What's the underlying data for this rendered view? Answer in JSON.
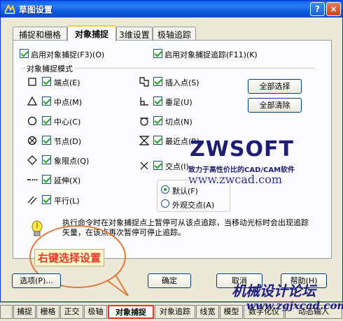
{
  "window": {
    "title": "草图设置",
    "help_glyph": "?",
    "close_glyph": "×"
  },
  "tabs": [
    {
      "label": "捕捉和栅格",
      "active": false
    },
    {
      "label": "对象捕捉",
      "active": true
    },
    {
      "label": "3维设置",
      "active": false
    },
    {
      "label": "极轴追踪",
      "active": false
    }
  ],
  "options": {
    "snap_on": "启用对象捕捉(F3)(O)",
    "track_on": "启用对象捕捉追踪(F11)(K)"
  },
  "group": {
    "title": "对象捕捉模式",
    "left": [
      {
        "label": "端点(E)",
        "icon": "square-icon"
      },
      {
        "label": "中点(M)",
        "icon": "triangle-icon"
      },
      {
        "label": "中心(C)",
        "icon": "circle-icon"
      },
      {
        "label": "节点(D)",
        "icon": "node-icon"
      },
      {
        "label": "象限点(Q)",
        "icon": "diamond-icon"
      },
      {
        "label": "延伸(X)",
        "icon": "extension-icon"
      },
      {
        "label": "平行(L)",
        "icon": "parallel-icon"
      }
    ],
    "right": [
      {
        "label": "插入点(S)",
        "icon": "insert-icon"
      },
      {
        "label": "垂足(U)",
        "icon": "perpendicular-icon"
      },
      {
        "label": "切点(N)",
        "icon": "tangent-icon"
      },
      {
        "label": "最近点(R)",
        "icon": "nearest-icon"
      },
      {
        "label": "交点(I)",
        "icon": "intersection-icon"
      }
    ],
    "select_all": "全部选择",
    "clear_all": "全部清除",
    "radio_default": "默认(F)",
    "radio_apparent": "外观交点(A)"
  },
  "hint": "执行命令时在对象捕捉点上暂停可从该点追踪，当移动光标时会出现追踪矢量，在该点再次暂停可停止追踪。",
  "buttons": {
    "options": "选项(P)...",
    "ok": "确定",
    "cancel": "取消",
    "help": "帮助(H)"
  },
  "watermark": {
    "logo": "ZWSOFT",
    "slogan": "致力于高性价比的CAD/CAM软件",
    "url": "www.zwcad.com",
    "forum": "机械设计论坛",
    "forum_url": "www.zgjxcad.com"
  },
  "callout": "右键选择设置",
  "statusbar": [
    {
      "label": "捕捉",
      "active": false
    },
    {
      "label": "栅格",
      "active": false
    },
    {
      "label": "正交",
      "active": false
    },
    {
      "label": "极轴",
      "active": false
    },
    {
      "label": "对象捕捉",
      "active": true
    },
    {
      "label": "对象追踪",
      "active": false
    },
    {
      "label": "线宽",
      "active": false
    },
    {
      "label": "模型",
      "active": false
    },
    {
      "label": "数字化仪",
      "active": false
    },
    {
      "label": "动态输入",
      "active": false
    }
  ],
  "colors": {
    "titlebar": "#0a5fe8",
    "callout_red": "#e0392a",
    "check_green": "#21a121"
  }
}
